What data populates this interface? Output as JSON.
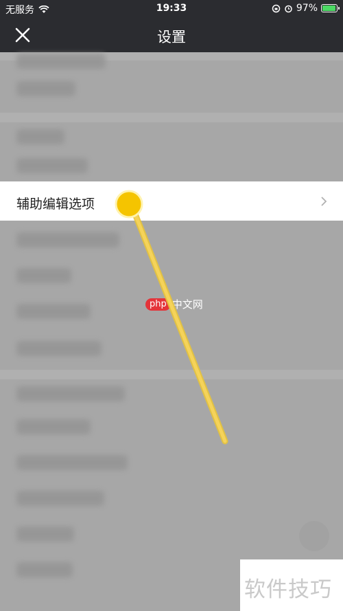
{
  "status_bar": {
    "carrier": "无服务",
    "time": "19:33",
    "battery_percent": "97%",
    "battery_level": 0.97,
    "battery_color": "#4cd964"
  },
  "nav": {
    "title": "设置",
    "close_icon": "close-icon"
  },
  "settings": {
    "highlighted_item": "辅助编辑选项",
    "chevron_icon": "chevron-right-icon"
  },
  "watermark": {
    "badge": "php",
    "text": "中文网"
  },
  "corner_watermark": "软件技巧",
  "colors": {
    "nav_background": "#2b2c30",
    "overlay": "#a7a7a7",
    "pointer_yellow": "#f5c400"
  }
}
